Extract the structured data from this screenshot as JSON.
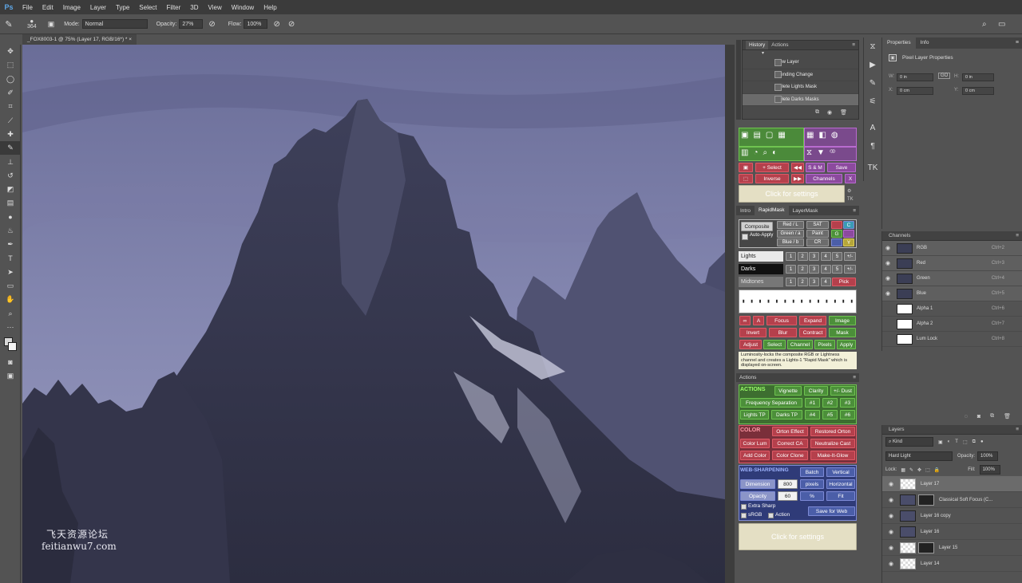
{
  "menu": {
    "logo": "Ps",
    "items": [
      "File",
      "Edit",
      "Image",
      "Layer",
      "Type",
      "Select",
      "Filter",
      "3D",
      "View",
      "Window",
      "Help"
    ]
  },
  "options": {
    "brush_size": "364",
    "mode_label": "Mode:",
    "mode_value": "Normal",
    "opacity_label": "Opacity:",
    "opacity_value": "27%",
    "flow_label": "Flow:",
    "flow_value": "100%"
  },
  "document": {
    "tab_title": "_FOX8003-1 @ 75% (Layer 17, RGB/16*) *",
    "watermark_cn": "飞天资源论坛",
    "watermark_url": "feitianwu7.com"
  },
  "history": {
    "tabs": [
      "History",
      "Actions"
    ],
    "items": [
      "New Layer",
      "Blending Change",
      "Delete Lights Mask",
      "Delete Darks Masks"
    ]
  },
  "rapidmask": {
    "select_btn": "+ Select",
    "sm_btn": "S & M",
    "save_btn": "Save",
    "inverse_btn": "Inverse",
    "channels_btn": "Channels",
    "close_btn": "X",
    "click_settings": "Click for settings",
    "tabs": [
      "Intro",
      "RapidMask",
      "LayerMask"
    ],
    "composite": "Composite",
    "auto_apply": "Auto-Apply",
    "red_btn": "Red / L",
    "green_btn": "Green / a",
    "blue_btn": "Blue / b",
    "sat_btn": "SAT",
    "paint_btn": "Paint",
    "cr_btn": "CR",
    "c_btn": "C",
    "g_btn": "G",
    "y_btn": "Y",
    "lights": "Lights",
    "darks": "Darks",
    "midtones": "Midtones",
    "pick": "Pick",
    "nums": [
      "1",
      "2",
      "3",
      "4",
      "5"
    ],
    "plusminus": "+/-",
    "row_a": [
      "A",
      "Focus",
      "Expand",
      "Image"
    ],
    "row_b": [
      "Invert",
      "Blur",
      "Contract",
      "Mask"
    ],
    "row_c": [
      "Adjust",
      "Select",
      "Channel",
      "Pixels",
      "Apply"
    ],
    "infotext": "Luminosity-locks the composite RGB or Lightness channel and creates a Lights-1 \"Rapid Mask\" which is displayed on-screen."
  },
  "actions": {
    "title": "Actions",
    "actions_label": "ACTIONS",
    "vignette": "Vignette",
    "clarity": "Clarity",
    "dust": "+/- Dust",
    "freq_sep": "Frequency Separation",
    "n1": "#1",
    "n2": "#2",
    "n3": "#3",
    "lights_tp": "Lights TP",
    "darks_tp": "Darks TP",
    "n4": "#4",
    "n5": "#5",
    "n6": "#6",
    "color_label": "COLOR",
    "orton": "Orton Effect",
    "restored_orton": "Restored Orton",
    "color_lum": "Color Lum",
    "correct_ca": "Correct CA",
    "neutralize_cast": "Neutralize Cast",
    "add_color": "Add Color",
    "color_clone": "Color Clone",
    "make_it_glow": "Make-It-Glow",
    "web_label": "WEB-SHARPENING",
    "batch": "Batch",
    "vertical": "Vertical",
    "dimension": "Dimension",
    "dim_val": "800",
    "pixels": "pixels",
    "horizontal": "Horizontal",
    "opacity": "Opacity",
    "op_val": "60",
    "pct": "%",
    "fit": "Fit",
    "extra_sharp": "Extra Sharp",
    "srgb": "sRGB",
    "action": "Action",
    "save_web": "Save for Web",
    "click_settings": "Click for settings"
  },
  "properties": {
    "tabs": [
      "Properties",
      "Info"
    ],
    "title": "Pixel Layer Properties",
    "w_label": "W:",
    "w_val": "0 in",
    "h_label": "H:",
    "h_val": "0 in",
    "x_label": "X:",
    "x_val": "0 cm",
    "y_label": "Y:",
    "y_val": "0 cm",
    "link": "GO"
  },
  "channels": {
    "title": "Channels",
    "rows": [
      {
        "name": "RGB",
        "shortcut": "Ctrl+2"
      },
      {
        "name": "Red",
        "shortcut": "Ctrl+3"
      },
      {
        "name": "Green",
        "shortcut": "Ctrl+4"
      },
      {
        "name": "Blue",
        "shortcut": "Ctrl+5"
      },
      {
        "name": "Alpha 1",
        "shortcut": "Ctrl+6"
      },
      {
        "name": "Alpha 2",
        "shortcut": "Ctrl+7"
      },
      {
        "name": "Lum Lock",
        "shortcut": "Ctrl+8"
      }
    ]
  },
  "layers": {
    "title": "Layers",
    "kind": "Kind",
    "blend": "Hard Light",
    "opacity_label": "Opacity:",
    "opacity_val": "100%",
    "lock_label": "Lock:",
    "fill_label": "Fill:",
    "fill_val": "100%",
    "rows": [
      "Layer 17",
      "Classical Soft Focus (C...",
      "Layer 16 copy",
      "Layer 16",
      "Layer 15",
      "Layer 14"
    ]
  }
}
